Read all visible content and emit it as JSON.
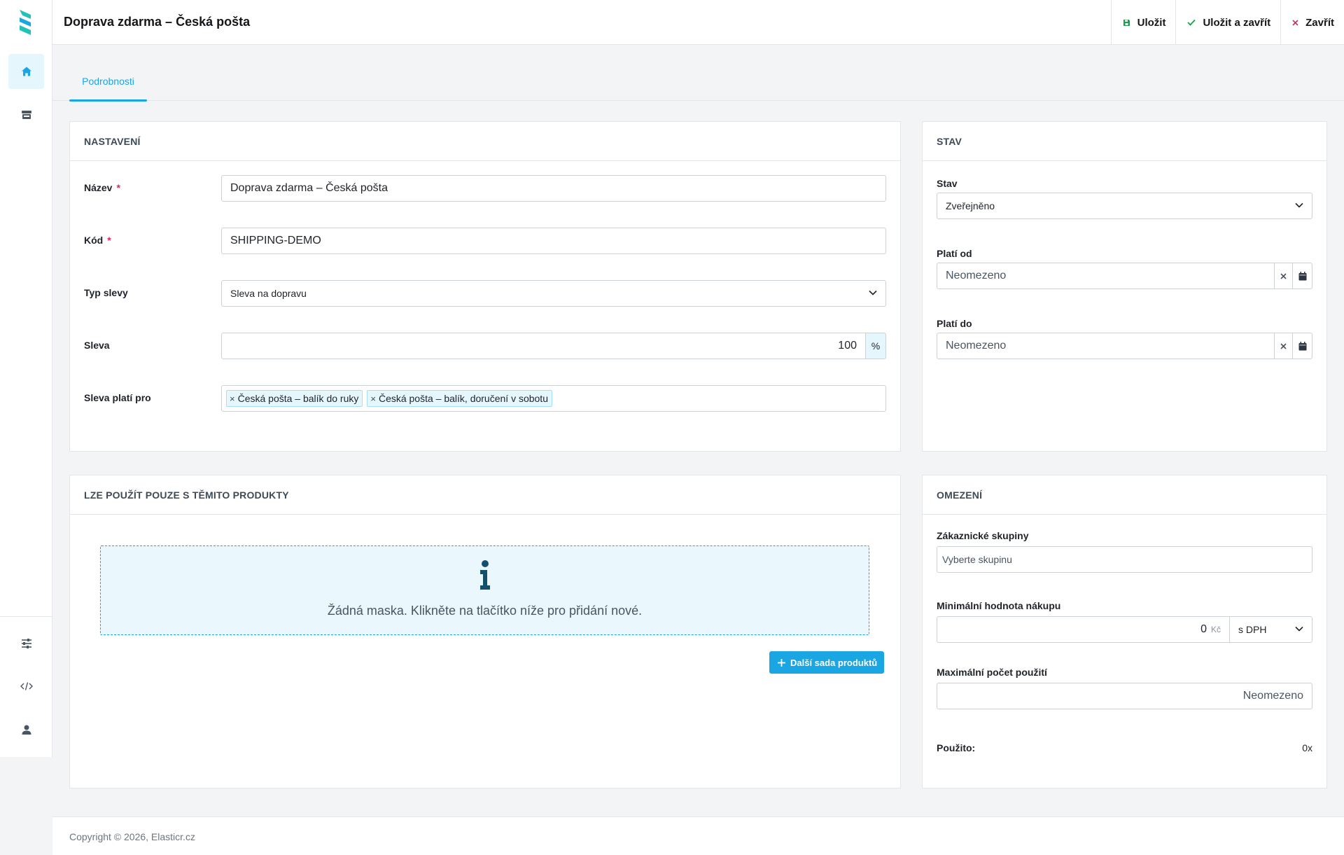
{
  "header": {
    "title": "Doprava zdarma – Česká pošta",
    "actions": {
      "save": "Uložit",
      "save_close": "Uložit a zavřít",
      "close": "Zavřít"
    }
  },
  "sidebar": {
    "items": [
      {
        "icon": "home-icon",
        "active": true
      },
      {
        "icon": "store-icon",
        "active": false
      },
      {
        "icon": "sliders-icon",
        "active": false
      },
      {
        "icon": "code-icon",
        "active": false
      },
      {
        "icon": "user-icon",
        "active": false
      }
    ]
  },
  "tabs": [
    {
      "label": "Podrobnosti",
      "active": true
    }
  ],
  "settings": {
    "heading": "NASTAVENÍ",
    "name_label": "Název",
    "name_value": "Doprava zdarma – Česká pošta",
    "code_label": "Kód",
    "code_value": "SHIPPING-DEMO",
    "type_label": "Typ slevy",
    "type_value": "Sleva na dopravu",
    "discount_label": "Sleva",
    "discount_value": "100",
    "discount_unit": "%",
    "applies_label": "Sleva platí pro",
    "applies_tags": [
      "Česká pošta – balík do ruky",
      "Česká pošta – balík, doručení v sobotu"
    ]
  },
  "status": {
    "heading": "STAV",
    "state_label": "Stav",
    "state_value": "Zveřejněno",
    "valid_from_label": "Platí od",
    "valid_from_value": "Neomezeno",
    "valid_to_label": "Platí do",
    "valid_to_value": "Neomezeno"
  },
  "products": {
    "heading": "LZE POUŽÍT POUZE S TĚMITO PRODUKTY",
    "empty_message": "Žádná maska. Klikněte na tlačítko níže pro přidání nové.",
    "add_button": "Další sada produktů"
  },
  "limits": {
    "heading": "OMEZENÍ",
    "groups_label": "Zákaznické skupiny",
    "groups_placeholder": "Vyberte skupinu",
    "min_label": "Minimální hodnota nákupu",
    "min_value": "0",
    "min_currency": "Kč",
    "min_vat": "s DPH",
    "max_label": "Maximální počet použití",
    "max_value": "Neomezeno",
    "used_label": "Použito:",
    "used_value": "0x"
  },
  "footer": {
    "copyright": "Copyright © 2026, Elasticr.cz"
  },
  "colors": {
    "accent": "#1aa5e3",
    "required": "#e0245e",
    "save_icon": "#1a9e4b"
  }
}
